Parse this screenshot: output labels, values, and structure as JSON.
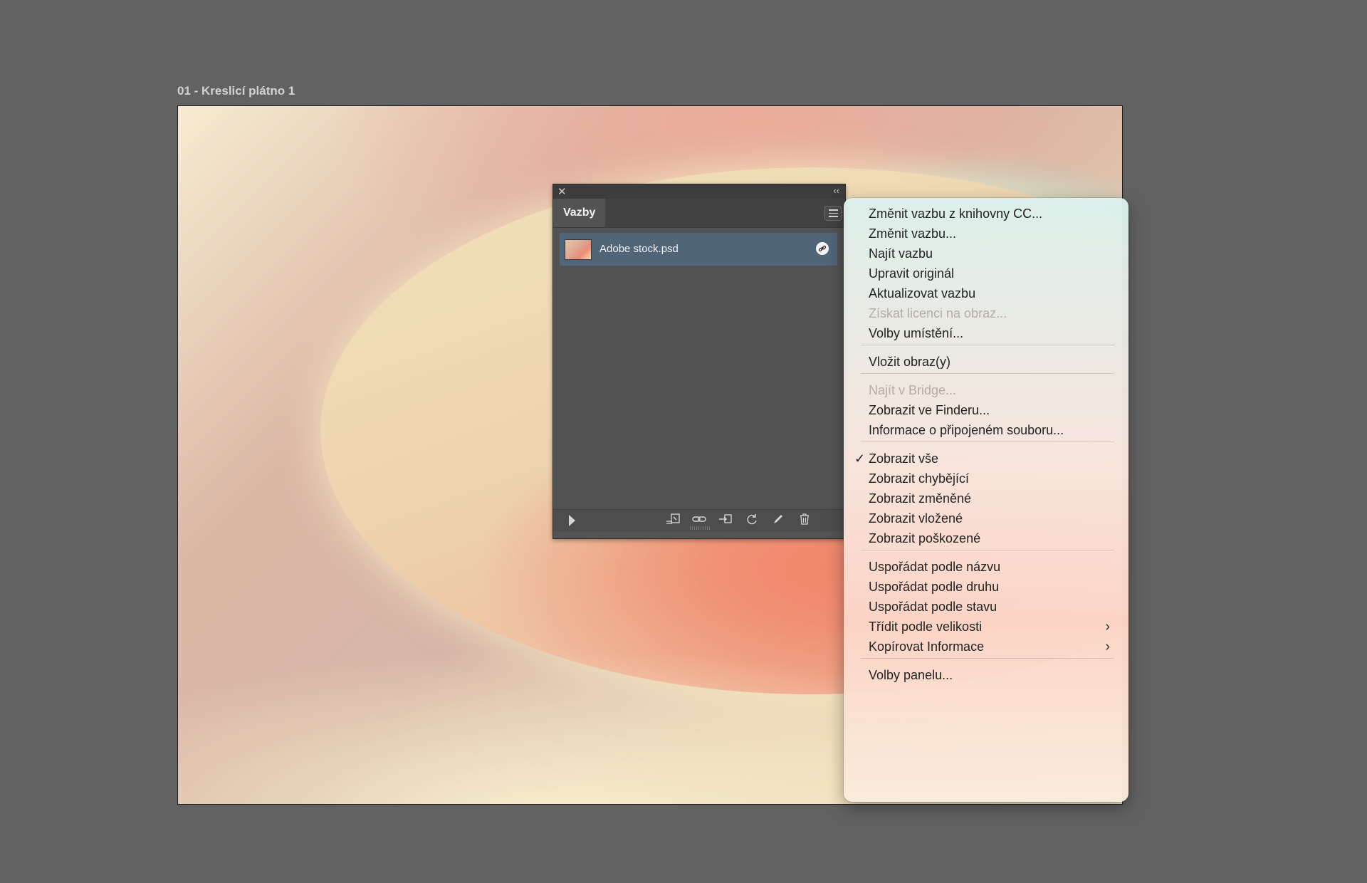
{
  "artboard": {
    "title": "01 - Kreslicí plátno 1"
  },
  "links_panel": {
    "tab_label": "Vazby",
    "close_glyph": "✕",
    "collapse_glyph": "‹‹",
    "items": [
      {
        "name": "Adobe stock.psd",
        "status_icon": "link-icon"
      }
    ],
    "toolbar_icons": [
      "relink-cc-library-icon",
      "relink-icon",
      "go-to-link-icon",
      "update-link-icon",
      "edit-original-icon",
      "delete-icon"
    ]
  },
  "context_menu": {
    "items": [
      {
        "label": "Změnit vazbu z knihovny CC...",
        "enabled": true
      },
      {
        "label": "Změnit vazbu...",
        "enabled": true
      },
      {
        "label": "Najít vazbu",
        "enabled": true
      },
      {
        "label": "Upravit originál",
        "enabled": true
      },
      {
        "label": "Aktualizovat vazbu",
        "enabled": true
      },
      {
        "label": "Získat licenci na obraz...",
        "enabled": false
      },
      {
        "label": "Volby umístění...",
        "enabled": true
      },
      {
        "label": "Vložit obraz(y)",
        "enabled": true
      },
      {
        "label": "Najít v Bridge...",
        "enabled": false
      },
      {
        "label": "Zobrazit ve Finderu...",
        "enabled": true
      },
      {
        "label": "Informace o připojeném souboru...",
        "enabled": true
      },
      {
        "label": "Zobrazit vše",
        "enabled": true,
        "checked": true
      },
      {
        "label": "Zobrazit chybějící",
        "enabled": true
      },
      {
        "label": "Zobrazit změněné",
        "enabled": true
      },
      {
        "label": "Zobrazit vložené",
        "enabled": true
      },
      {
        "label": "Zobrazit poškozené",
        "enabled": true
      },
      {
        "label": "Uspořádat podle názvu",
        "enabled": true
      },
      {
        "label": "Uspořádat podle druhu",
        "enabled": true
      },
      {
        "label": "Uspořádat podle stavu",
        "enabled": true
      },
      {
        "label": "Třídit podle velikosti",
        "enabled": true,
        "submenu": true
      },
      {
        "label": "Kopírovat Informace",
        "enabled": true,
        "submenu": true
      },
      {
        "label": "Volby panelu...",
        "enabled": true
      }
    ],
    "check_glyph": "✓",
    "submenu_glyph": "›"
  }
}
